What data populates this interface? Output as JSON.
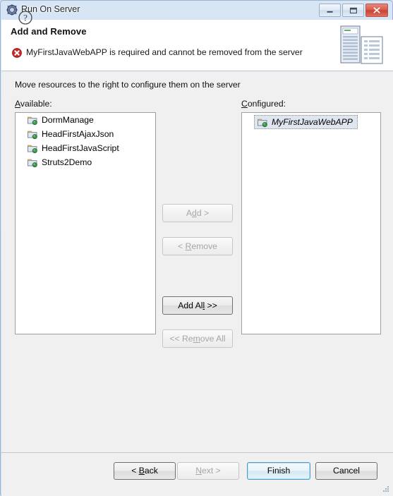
{
  "window": {
    "title": "Run On Server",
    "icon": "run-on-server-icon",
    "controls": {
      "minimize": "minimize-icon",
      "maximize": "restore-icon",
      "close": "close-icon"
    }
  },
  "header": {
    "title": "Add and Remove",
    "message": "MyFirstJavaWebAPP is required and cannot be removed from the server",
    "message_icon": "error-icon",
    "banner_icon": "server-and-document-icon"
  },
  "main": {
    "instruction": "Move resources to the right to configure them on the server",
    "available": {
      "label_prefix": "A",
      "label_rest": "vailable:",
      "items": [
        {
          "name": "DormManage",
          "icon": "project-icon"
        },
        {
          "name": "HeadFirstAjaxJson",
          "icon": "project-icon"
        },
        {
          "name": "HeadFirstJavaScript",
          "icon": "project-icon"
        },
        {
          "name": "Struts2Demo",
          "icon": "project-icon"
        }
      ]
    },
    "configured": {
      "label_prefix": "C",
      "label_rest": "onfigured:",
      "items": [
        {
          "name": "MyFirstJavaWebAPP",
          "icon": "project-icon",
          "selected": true
        }
      ]
    },
    "transfer_buttons": [
      {
        "id": "add",
        "pre": "A",
        "mn": "d",
        "post": "d >",
        "enabled": false
      },
      {
        "id": "remove",
        "pre": "< ",
        "mn": "R",
        "post": "emove",
        "enabled": false
      },
      {
        "id": "add_all",
        "pre": "Add Al",
        "mn": "l",
        "post": " >>",
        "enabled": true
      },
      {
        "id": "remove_all",
        "pre": "<< Re",
        "mn": "m",
        "post": "ove All",
        "enabled": false
      }
    ]
  },
  "footer": {
    "help_icon": "help-icon",
    "buttons": [
      {
        "id": "back",
        "pre": "< ",
        "mn": "B",
        "post": "ack",
        "state": "enabled"
      },
      {
        "id": "next",
        "pre": "",
        "mn": "N",
        "post": "ext >",
        "state": "disabled"
      },
      {
        "id": "finish",
        "pre": "Finish",
        "mn": "",
        "post": "",
        "state": "default"
      },
      {
        "id": "cancel",
        "pre": "Cancel",
        "mn": "",
        "post": "",
        "state": "enabled"
      }
    ]
  },
  "colors": {
    "frame": "#cfe0f2",
    "error": "#cc2b2b",
    "default_button_border": "#4a9ec4",
    "close_button": "#d9584a"
  }
}
